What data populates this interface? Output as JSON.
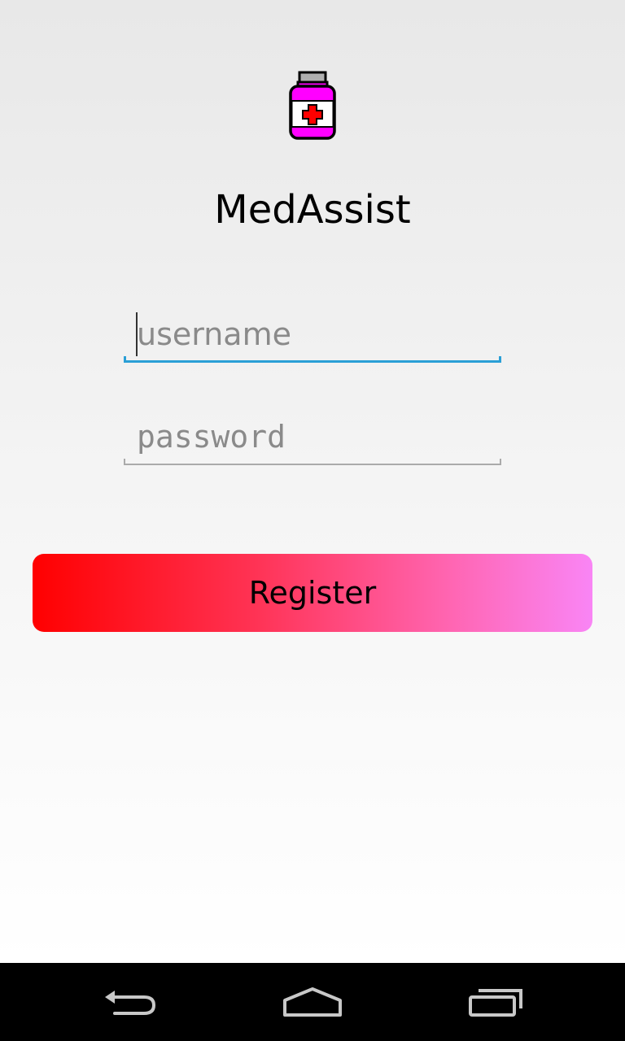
{
  "app": {
    "title": "MedAssist",
    "icon": "medicine-bottle-icon"
  },
  "form": {
    "username": {
      "value": "",
      "placeholder": "username",
      "focused": true
    },
    "password": {
      "value": "",
      "placeholder": "password"
    },
    "register_label": "Register"
  },
  "colors": {
    "button_gradient": [
      "#ff0000",
      "#f985f5"
    ],
    "focus_underline": "#2a9fd6",
    "bottle_body": "#ff00ff",
    "bottle_cross": "#ff0000"
  },
  "navbar": {
    "back_icon": "back-icon",
    "home_icon": "home-icon",
    "recents_icon": "recents-icon"
  }
}
